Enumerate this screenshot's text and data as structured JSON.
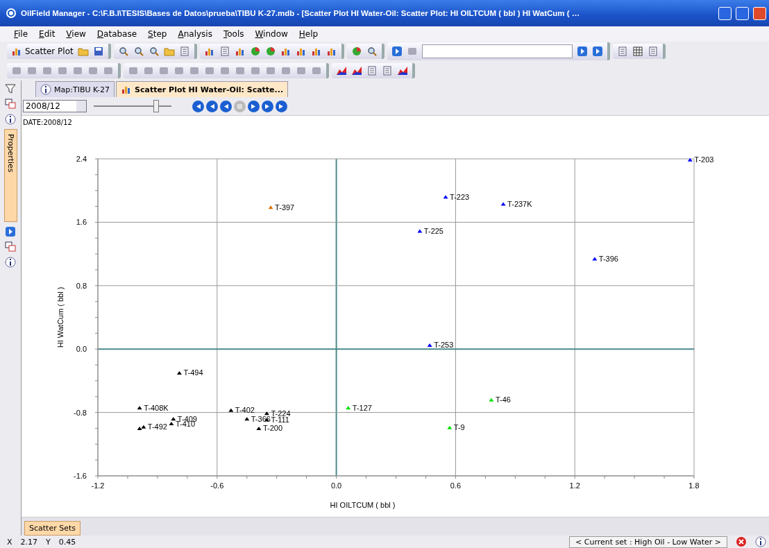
{
  "window": {
    "title": "OilField Manager - C:\\F.B.I\\TESIS\\Bases de Datos\\prueba\\TIBU K-27.mdb - [Scatter Plot HI Water-Oil: Scatter Plot: HI OILTCUM ( bbl ) HI WatCum ( …"
  },
  "menu": [
    "File",
    "Edit",
    "View",
    "Database",
    "Step",
    "Analysis",
    "Tools",
    "Window",
    "Help"
  ],
  "toolbar": {
    "plot_type": "Scatter Plot"
  },
  "side_panel": {
    "label": "Properties"
  },
  "tabs": [
    {
      "label": "Map:TIBU K-27",
      "selected": false
    },
    {
      "label": "Scatter Plot HI Water-Oil: Scatte...",
      "selected": true
    }
  ],
  "date_bar": {
    "date": "2008/12",
    "slider": {
      "level": 0.8
    },
    "playback": [
      {
        "disabled": false
      },
      {
        "disabled": false
      },
      {
        "disabled": false
      },
      {
        "disabled": true
      },
      {
        "disabled": false
      },
      {
        "disabled": false
      },
      {
        "disabled": false
      }
    ]
  },
  "date_label": "DATE:2008/12",
  "chart_data": {
    "type": "scatter",
    "grid": true,
    "xlabel": "HI OILTCUM ( bbl )",
    "ylabel": "HI WatCum ( bbl )",
    "xlim": [
      -1.2,
      1.8
    ],
    "ylim": [
      -1.6,
      2.4
    ],
    "xticks": [
      {
        "value": -1.2,
        "label": "-1.2"
      },
      {
        "value": -0.6,
        "label": "-0.6"
      },
      {
        "value": 0,
        "label": "0.0"
      },
      {
        "value": 0.6,
        "label": "0.6"
      },
      {
        "value": 1.2,
        "label": "1.2"
      },
      {
        "value": 1.8,
        "label": "1.8"
      }
    ],
    "yticks": [
      {
        "value": -1.6,
        "label": "-1.6"
      },
      {
        "value": -0.8,
        "label": "-0.8"
      },
      {
        "value": 0,
        "label": "0.0"
      },
      {
        "value": 0.8,
        "label": "0.8"
      },
      {
        "value": 1.6,
        "label": "1.6"
      },
      {
        "value": 2.4,
        "label": "2.4"
      }
    ],
    "series": [
      {
        "color": "#0000ff",
        "x": [
          1.78,
          0.55,
          0.84,
          0.42,
          1.3,
          0.47
        ],
        "values": [
          2.39,
          1.92,
          1.83,
          1.49,
          1.14,
          0.05
        ]
      },
      {
        "color": "#e07000",
        "x": [
          -0.33
        ],
        "values": [
          1.79
        ]
      },
      {
        "color": "#000000",
        "x": [
          -0.79,
          -0.99,
          -0.82,
          -0.83,
          -0.97,
          -0.99,
          -0.53,
          -0.35,
          -0.45,
          -0.35,
          -0.39
        ],
        "values": [
          -0.3,
          -0.74,
          -0.88,
          -0.94,
          -0.98,
          -1.0,
          -0.77,
          -0.81,
          -0.88,
          -0.89,
          -1.0
        ]
      },
      {
        "color": "#00e000",
        "x": [
          0.06,
          0.78,
          0.57
        ],
        "values": [
          -0.74,
          -0.64,
          -0.99
        ]
      }
    ],
    "annotations": [
      {
        "x": 1.78,
        "y": 2.39,
        "text": "T-203"
      },
      {
        "x": 0.55,
        "y": 1.92,
        "text": "T-223"
      },
      {
        "x": 0.84,
        "y": 1.83,
        "text": "T-237K"
      },
      {
        "x": 0.42,
        "y": 1.49,
        "text": "T-225"
      },
      {
        "x": 1.3,
        "y": 1.14,
        "text": "T-396"
      },
      {
        "x": 0.47,
        "y": 0.05,
        "text": "T-253"
      },
      {
        "x": -0.33,
        "y": 1.79,
        "text": "T-397"
      },
      {
        "x": -0.79,
        "y": -0.3,
        "text": "T-494"
      },
      {
        "x": -0.99,
        "y": -0.74,
        "text": "T-408K"
      },
      {
        "x": -0.82,
        "y": -0.88,
        "text": "T-409"
      },
      {
        "x": -0.83,
        "y": -0.94,
        "text": "T-410"
      },
      {
        "x": -0.97,
        "y": -0.98,
        "text": "T-492"
      },
      {
        "x": -0.53,
        "y": -0.77,
        "text": "T-402"
      },
      {
        "x": -0.35,
        "y": -0.81,
        "text": "T-224"
      },
      {
        "x": -0.45,
        "y": -0.88,
        "text": "T-366"
      },
      {
        "x": -0.35,
        "y": -0.89,
        "text": "T-111"
      },
      {
        "x": -0.39,
        "y": -1.0,
        "text": "T-200"
      },
      {
        "x": 0.06,
        "y": -0.74,
        "text": "T-127"
      },
      {
        "x": 0.78,
        "y": -0.64,
        "text": "T-46"
      },
      {
        "x": 0.57,
        "y": -0.99,
        "text": "T-9"
      }
    ]
  },
  "bottom_tabs": [
    {
      "label": "Scatter Sets",
      "selected": true
    }
  ],
  "status_bar": {
    "x_label": "X",
    "x_value": "2.17",
    "y_label": "Y",
    "y_value": "0.45",
    "current_set": "< Current set : High Oil - Low Water >"
  }
}
